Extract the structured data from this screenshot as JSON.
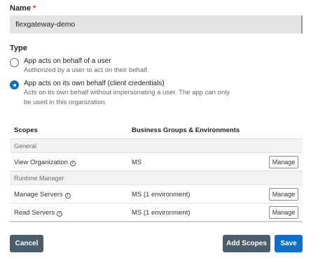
{
  "name_field": {
    "label": "Name",
    "required_mark": "*",
    "value": "flexgateway-demo"
  },
  "type": {
    "label": "Type",
    "options": [
      {
        "title": "App acts on behalf of a user",
        "description": "Authorized by a user to act on their behalf.",
        "checked": false
      },
      {
        "title": "App acts on its own behalf (client credentials)",
        "description": "Acts on its own behalf without impersonating a user. The app can only be used in this organization.",
        "checked": true
      }
    ]
  },
  "scopes_table": {
    "headers": {
      "scopes": "Scopes",
      "groups": "Business Groups & Environments"
    },
    "groups": [
      {
        "name": "General",
        "rows": [
          {
            "scope": "View Organization",
            "env": "MS",
            "action": "Manage"
          }
        ]
      },
      {
        "name": "Runtime Manager",
        "rows": [
          {
            "scope": "Manage Servers",
            "env": "MS  (1 environment)",
            "action": "Manage"
          },
          {
            "scope": "Read Servers",
            "env": "MS  (1 environment)",
            "action": "Manage"
          }
        ]
      }
    ]
  },
  "actions": {
    "cancel": "Cancel",
    "add_scopes": "Add Scopes",
    "save": "Save"
  },
  "icons": {
    "info": "info-icon"
  },
  "colors": {
    "primary": "#0f6fc6",
    "secondary": "#4b5d6b",
    "required": "#c0392b"
  }
}
